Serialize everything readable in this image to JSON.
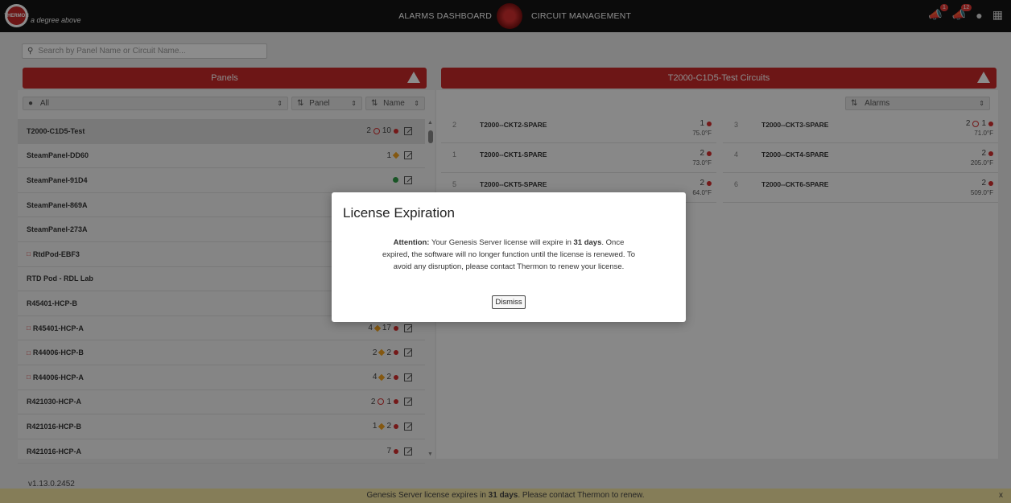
{
  "header": {
    "logo_text": "THERMON",
    "tagline": "a degree above",
    "nav_alarms": "ALARMS DASHBOARD",
    "nav_circuit": "CIRCUIT MANAGEMENT",
    "alarm_badge_1": "1",
    "alarm_badge_2": "12"
  },
  "search": {
    "placeholder": "Search by Panel Name or Circuit Name..."
  },
  "panels": {
    "title": "Panels",
    "filter_location": "All",
    "filter_sort_by": "Panel",
    "filter_sort_name": "Name",
    "rows": [
      {
        "name": "T2000-C1D5-Test",
        "a": "2",
        "b": "10"
      },
      {
        "name": "SteamPanel-DD60",
        "a": "1"
      },
      {
        "name": "SteamPanel-91D4"
      },
      {
        "name": "SteamPanel-869A"
      },
      {
        "name": "SteamPanel-273A"
      },
      {
        "name": "RtdPod-EBF3"
      },
      {
        "name": "RTD Pod - RDL Lab"
      },
      {
        "name": "R45401-HCP-B"
      },
      {
        "name": "R45401-HCP-A",
        "a": "4",
        "b": "17"
      },
      {
        "name": "R44006-HCP-B",
        "a": "2",
        "b": "2"
      },
      {
        "name": "R44006-HCP-A",
        "a": "4",
        "b": "2"
      },
      {
        "name": "R421030-HCP-A",
        "a": "2",
        "b": "1"
      },
      {
        "name": "R421016-HCP-B",
        "a": "1",
        "b": "2"
      },
      {
        "name": "R421016-HCP-A",
        "a": "7"
      }
    ]
  },
  "circuits": {
    "title": "T2000-C1D5-Test Circuits",
    "sort": "Alarms",
    "items": [
      {
        "num": "2",
        "name": "T2000--CKT2-SPARE",
        "count": "1",
        "temp": "75.0°F"
      },
      {
        "num": "3",
        "name": "T2000--CKT3-SPARE",
        "count_a": "2",
        "count": "1",
        "temp": "71.0°F"
      },
      {
        "num": "1",
        "name": "T2000--CKT1-SPARE",
        "count": "2",
        "temp": "73.0°F"
      },
      {
        "num": "4",
        "name": "T2000--CKT4-SPARE",
        "count": "2",
        "temp": "205.0°F"
      },
      {
        "num": "5",
        "name": "T2000--CKT5-SPARE",
        "count": "2",
        "temp": "64.0°F"
      },
      {
        "num": "6",
        "name": "T2000--CKT6-SPARE",
        "count": "2",
        "temp": "509.0°F"
      }
    ]
  },
  "version": "v1.13.0.2452",
  "footer": {
    "pre": "Genesis Server license expires in ",
    "days": "31 days",
    "post": ". Please contact Thermon to renew.",
    "close": "x"
  },
  "modal": {
    "title": "License Expiration",
    "attention": "Attention:",
    "text1": " Your Genesis Server license will expire in ",
    "days": "31 days",
    "text2": ". Once expired, the software will no longer function until the license is renewed. To avoid any disruption, please contact Thermon to renew your license.",
    "button": "Dismiss"
  }
}
